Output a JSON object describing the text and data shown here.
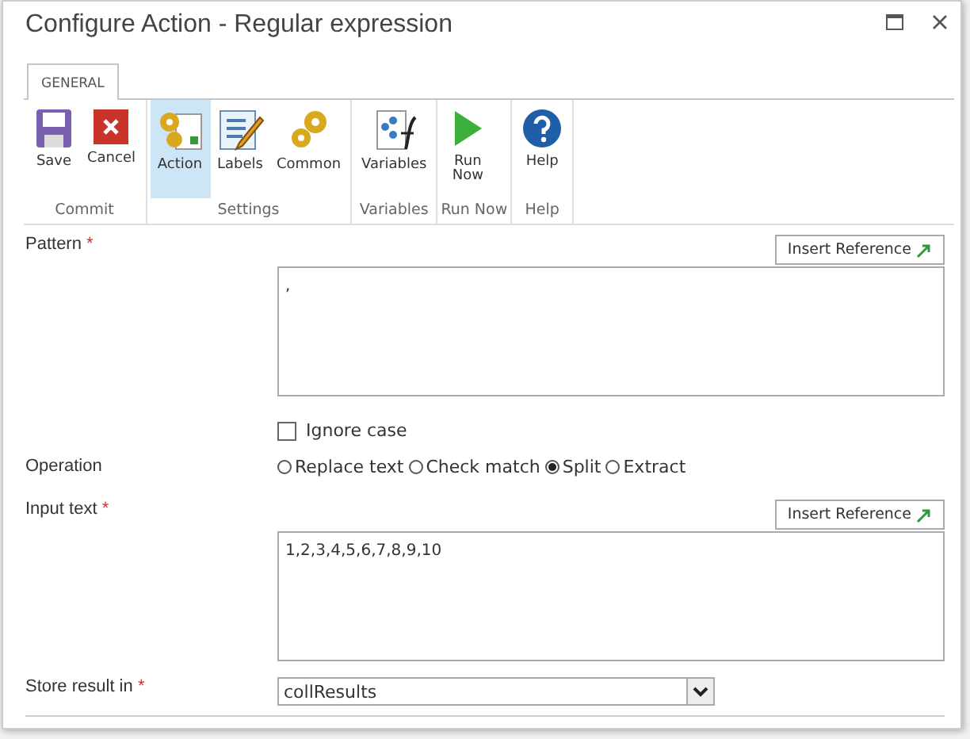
{
  "window": {
    "title": "Configure Action - Regular expression"
  },
  "tabs": [
    {
      "label": "GENERAL",
      "selected": true
    }
  ],
  "ribbon": {
    "groups": [
      {
        "label": "Commit",
        "buttons": [
          {
            "kind": "save",
            "label": "Save",
            "selected": false
          },
          {
            "kind": "cancel",
            "label": "Cancel",
            "selected": false
          }
        ]
      },
      {
        "label": "Settings",
        "buttons": [
          {
            "kind": "action",
            "label": "Action",
            "selected": true
          },
          {
            "kind": "labels",
            "label": "Labels",
            "selected": false
          },
          {
            "kind": "common",
            "label": "Common",
            "selected": false
          }
        ]
      },
      {
        "label": "Variables",
        "buttons": [
          {
            "kind": "variables",
            "label": "Variables",
            "selected": false
          }
        ]
      },
      {
        "label": "Run Now",
        "buttons": [
          {
            "kind": "run",
            "label": "Run Now",
            "selected": false
          }
        ]
      },
      {
        "label": "Help",
        "buttons": [
          {
            "kind": "help",
            "label": "Help",
            "selected": false
          }
        ]
      }
    ]
  },
  "form": {
    "pattern": {
      "label": "Pattern",
      "required_mark": "*",
      "insert_button": "Insert Reference",
      "value": ","
    },
    "ignore_case": {
      "label": "Ignore case",
      "checked": false
    },
    "operation": {
      "label": "Operation",
      "options": [
        {
          "label": "Replace text",
          "selected": false
        },
        {
          "label": "Check match",
          "selected": false
        },
        {
          "label": "Split",
          "selected": true
        },
        {
          "label": "Extract",
          "selected": false
        }
      ]
    },
    "input_text": {
      "label": "Input text",
      "required_mark": "*",
      "insert_button": "Insert Reference",
      "value": "1,2,3,4,5,6,7,8,9,10"
    },
    "store_result": {
      "label": "Store result in",
      "required_mark": "*",
      "value": "collResults"
    }
  }
}
